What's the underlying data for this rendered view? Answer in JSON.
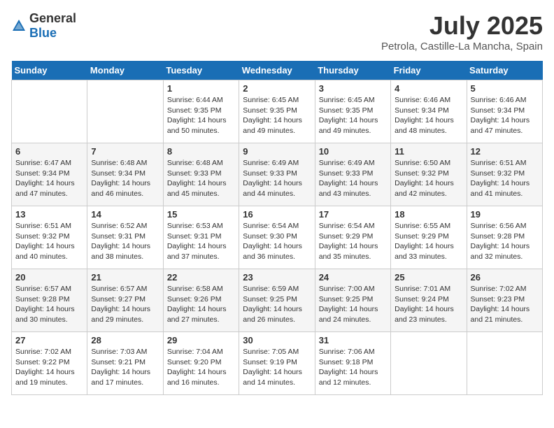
{
  "logo": {
    "general": "General",
    "blue": "Blue"
  },
  "header": {
    "month": "July 2025",
    "location": "Petrola, Castille-La Mancha, Spain"
  },
  "days_of_week": [
    "Sunday",
    "Monday",
    "Tuesday",
    "Wednesday",
    "Thursday",
    "Friday",
    "Saturday"
  ],
  "weeks": [
    [
      {
        "day": "",
        "info": ""
      },
      {
        "day": "",
        "info": ""
      },
      {
        "day": "1",
        "info": "Sunrise: 6:44 AM\nSunset: 9:35 PM\nDaylight: 14 hours and 50 minutes."
      },
      {
        "day": "2",
        "info": "Sunrise: 6:45 AM\nSunset: 9:35 PM\nDaylight: 14 hours and 49 minutes."
      },
      {
        "day": "3",
        "info": "Sunrise: 6:45 AM\nSunset: 9:35 PM\nDaylight: 14 hours and 49 minutes."
      },
      {
        "day": "4",
        "info": "Sunrise: 6:46 AM\nSunset: 9:34 PM\nDaylight: 14 hours and 48 minutes."
      },
      {
        "day": "5",
        "info": "Sunrise: 6:46 AM\nSunset: 9:34 PM\nDaylight: 14 hours and 47 minutes."
      }
    ],
    [
      {
        "day": "6",
        "info": "Sunrise: 6:47 AM\nSunset: 9:34 PM\nDaylight: 14 hours and 47 minutes."
      },
      {
        "day": "7",
        "info": "Sunrise: 6:48 AM\nSunset: 9:34 PM\nDaylight: 14 hours and 46 minutes."
      },
      {
        "day": "8",
        "info": "Sunrise: 6:48 AM\nSunset: 9:33 PM\nDaylight: 14 hours and 45 minutes."
      },
      {
        "day": "9",
        "info": "Sunrise: 6:49 AM\nSunset: 9:33 PM\nDaylight: 14 hours and 44 minutes."
      },
      {
        "day": "10",
        "info": "Sunrise: 6:49 AM\nSunset: 9:33 PM\nDaylight: 14 hours and 43 minutes."
      },
      {
        "day": "11",
        "info": "Sunrise: 6:50 AM\nSunset: 9:32 PM\nDaylight: 14 hours and 42 minutes."
      },
      {
        "day": "12",
        "info": "Sunrise: 6:51 AM\nSunset: 9:32 PM\nDaylight: 14 hours and 41 minutes."
      }
    ],
    [
      {
        "day": "13",
        "info": "Sunrise: 6:51 AM\nSunset: 9:32 PM\nDaylight: 14 hours and 40 minutes."
      },
      {
        "day": "14",
        "info": "Sunrise: 6:52 AM\nSunset: 9:31 PM\nDaylight: 14 hours and 38 minutes."
      },
      {
        "day": "15",
        "info": "Sunrise: 6:53 AM\nSunset: 9:31 PM\nDaylight: 14 hours and 37 minutes."
      },
      {
        "day": "16",
        "info": "Sunrise: 6:54 AM\nSunset: 9:30 PM\nDaylight: 14 hours and 36 minutes."
      },
      {
        "day": "17",
        "info": "Sunrise: 6:54 AM\nSunset: 9:29 PM\nDaylight: 14 hours and 35 minutes."
      },
      {
        "day": "18",
        "info": "Sunrise: 6:55 AM\nSunset: 9:29 PM\nDaylight: 14 hours and 33 minutes."
      },
      {
        "day": "19",
        "info": "Sunrise: 6:56 AM\nSunset: 9:28 PM\nDaylight: 14 hours and 32 minutes."
      }
    ],
    [
      {
        "day": "20",
        "info": "Sunrise: 6:57 AM\nSunset: 9:28 PM\nDaylight: 14 hours and 30 minutes."
      },
      {
        "day": "21",
        "info": "Sunrise: 6:57 AM\nSunset: 9:27 PM\nDaylight: 14 hours and 29 minutes."
      },
      {
        "day": "22",
        "info": "Sunrise: 6:58 AM\nSunset: 9:26 PM\nDaylight: 14 hours and 27 minutes."
      },
      {
        "day": "23",
        "info": "Sunrise: 6:59 AM\nSunset: 9:25 PM\nDaylight: 14 hours and 26 minutes."
      },
      {
        "day": "24",
        "info": "Sunrise: 7:00 AM\nSunset: 9:25 PM\nDaylight: 14 hours and 24 minutes."
      },
      {
        "day": "25",
        "info": "Sunrise: 7:01 AM\nSunset: 9:24 PM\nDaylight: 14 hours and 23 minutes."
      },
      {
        "day": "26",
        "info": "Sunrise: 7:02 AM\nSunset: 9:23 PM\nDaylight: 14 hours and 21 minutes."
      }
    ],
    [
      {
        "day": "27",
        "info": "Sunrise: 7:02 AM\nSunset: 9:22 PM\nDaylight: 14 hours and 19 minutes."
      },
      {
        "day": "28",
        "info": "Sunrise: 7:03 AM\nSunset: 9:21 PM\nDaylight: 14 hours and 17 minutes."
      },
      {
        "day": "29",
        "info": "Sunrise: 7:04 AM\nSunset: 9:20 PM\nDaylight: 14 hours and 16 minutes."
      },
      {
        "day": "30",
        "info": "Sunrise: 7:05 AM\nSunset: 9:19 PM\nDaylight: 14 hours and 14 minutes."
      },
      {
        "day": "31",
        "info": "Sunrise: 7:06 AM\nSunset: 9:18 PM\nDaylight: 14 hours and 12 minutes."
      },
      {
        "day": "",
        "info": ""
      },
      {
        "day": "",
        "info": ""
      }
    ]
  ]
}
